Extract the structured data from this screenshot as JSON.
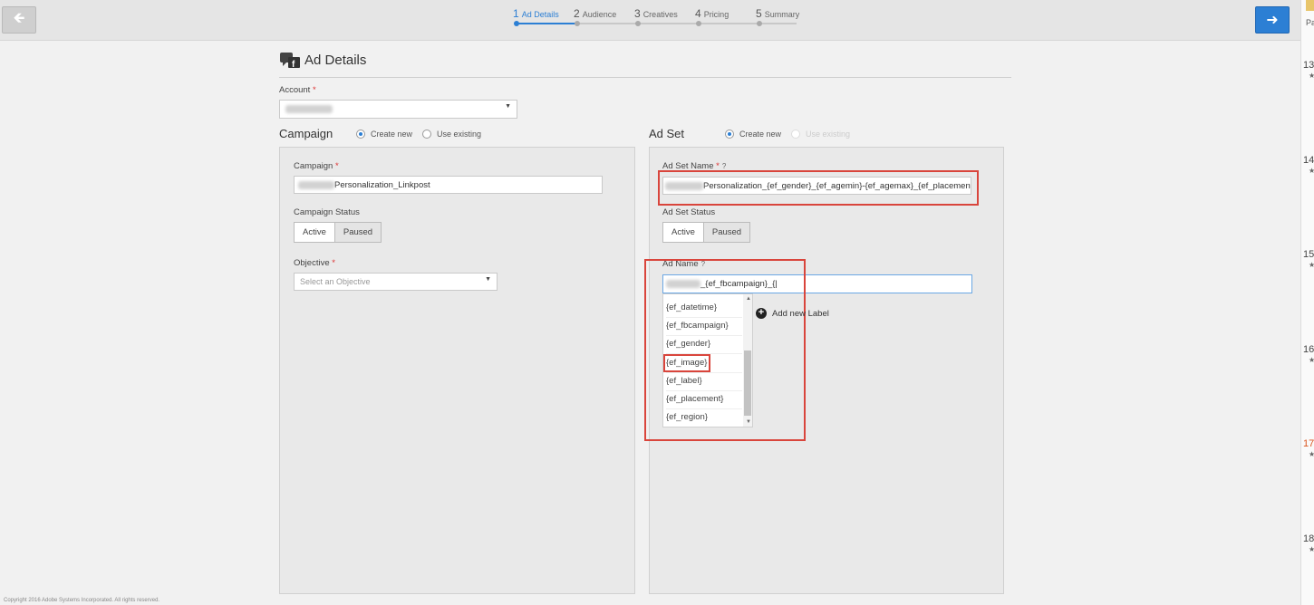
{
  "wizard": {
    "steps": [
      {
        "num": "1",
        "label": "Ad Details"
      },
      {
        "num": "2",
        "label": "Audience"
      },
      {
        "num": "3",
        "label": "Creatives"
      },
      {
        "num": "4",
        "label": "Pricing"
      },
      {
        "num": "5",
        "label": "Summary"
      }
    ],
    "active_step": 1,
    "back_icon": "arrow-left-icon",
    "next_icon": "arrow-right-icon"
  },
  "page": {
    "title": "Ad Details",
    "title_icon": "facebook-ads-icon"
  },
  "account": {
    "label": "Account",
    "required_mark": "*"
  },
  "campaign_section": {
    "heading": "Campaign",
    "radio_create": "Create new",
    "radio_existing": "Use existing",
    "campaign_label": "Campaign",
    "required_mark": "*",
    "campaign_value": "Personalization_Linkpost",
    "status_label": "Campaign Status",
    "status_active": "Active",
    "status_paused": "Paused",
    "objective_label": "Objective",
    "objective_placeholder": "Select an Objective"
  },
  "adset_section": {
    "heading": "Ad Set",
    "radio_create": "Create new",
    "radio_existing": "Use existing",
    "name_label": "Ad Set Name",
    "required_mark": "*",
    "help_mark": "?",
    "name_value": "Personalization_{ef_gender}_{ef_agemin}-{ef_agemax}_{ef_placement}",
    "status_label": "Ad Set Status",
    "status_active": "Active",
    "status_paused": "Paused",
    "ad_name_label": "Ad Name",
    "ad_name_value": "_{ef_fbcampaign}_{|",
    "add_label": "Add new Label",
    "macros": [
      "{ef_datetime}",
      "{ef_fbcampaign}",
      "{ef_gender}",
      "{ef_image}",
      "{ef_label}",
      "{ef_placement}",
      "{ef_region}"
    ]
  },
  "sidebar_calendar": {
    "top_text": "Pa",
    "days": [
      "13",
      "14",
      "15",
      "16",
      "17",
      "18"
    ],
    "star": "★",
    "highlight_day": "17"
  },
  "footer": {
    "copyright": "Copyright 2016 Adobe Systems Incorporated. All rights reserved."
  },
  "colors": {
    "accent": "#2c7fd4",
    "highlight_red": "#d9453c",
    "required_red": "#dd3333"
  }
}
